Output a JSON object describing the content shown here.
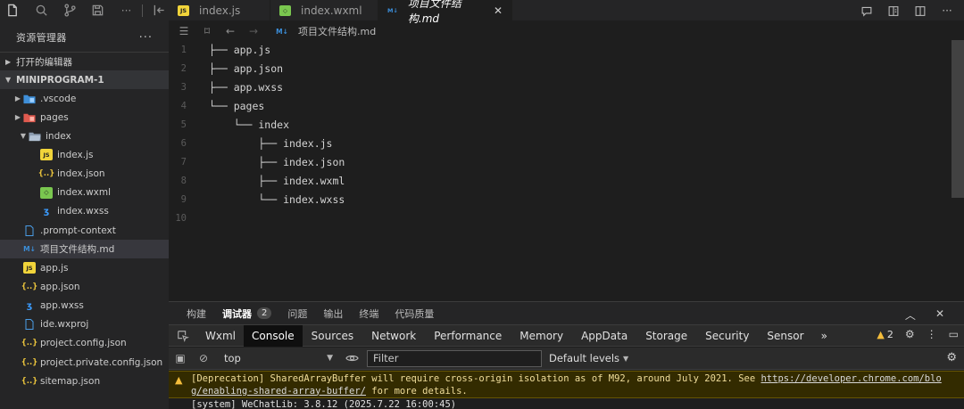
{
  "editor_tabs": [
    {
      "label": "index.js",
      "icon": "js"
    },
    {
      "label": "index.wxml",
      "icon": "wxml"
    },
    {
      "label": "项目文件结构.md",
      "icon": "md",
      "active": true
    }
  ],
  "sidebar": {
    "title": "资源管理器",
    "more": "···",
    "open_editors": "打开的编辑器",
    "project": "MINIPROGRAM-1",
    "tree": [
      {
        "label": ".vscode",
        "icon": "folder-blue",
        "indent": 1,
        "twisty": "▶"
      },
      {
        "label": "pages",
        "icon": "folder-red",
        "indent": 1,
        "twisty": "▶"
      },
      {
        "label": "index",
        "icon": "folder-grey",
        "indent": 2,
        "twisty": "▼"
      },
      {
        "label": "index.js",
        "icon": "js",
        "indent": 3
      },
      {
        "label": "index.json",
        "icon": "json",
        "indent": 3
      },
      {
        "label": "index.wxml",
        "icon": "wxml",
        "indent": 3
      },
      {
        "label": "index.wxss",
        "icon": "wxss",
        "indent": 3
      },
      {
        "label": ".prompt-context",
        "icon": "file",
        "indent": 1
      },
      {
        "label": "项目文件结构.md",
        "icon": "md",
        "indent": 1,
        "selected": true
      },
      {
        "label": "app.js",
        "icon": "js",
        "indent": 1
      },
      {
        "label": "app.json",
        "icon": "json",
        "indent": 1
      },
      {
        "label": "app.wxss",
        "icon": "wxss",
        "indent": 1
      },
      {
        "label": "ide.wxproj",
        "icon": "file",
        "indent": 1
      },
      {
        "label": "project.config.json",
        "icon": "json",
        "indent": 1
      },
      {
        "label": "project.private.config.json",
        "icon": "json",
        "indent": 1
      },
      {
        "label": "sitemap.json",
        "icon": "json",
        "indent": 1
      }
    ]
  },
  "breadcrumb": {
    "file": "项目文件结构.md"
  },
  "code_lines": [
    {
      "n": "1",
      "text": "├── app.js"
    },
    {
      "n": "2",
      "text": "├── app.json"
    },
    {
      "n": "3",
      "text": "├── app.wxss"
    },
    {
      "n": "4",
      "text": "└── pages"
    },
    {
      "n": "5",
      "text": "    └── index"
    },
    {
      "n": "6",
      "text": "        ├── index.js"
    },
    {
      "n": "7",
      "text": "        ├── index.json"
    },
    {
      "n": "8",
      "text": "        ├── index.wxml"
    },
    {
      "n": "9",
      "text": "        └── index.wxss"
    },
    {
      "n": "10",
      "text": ""
    }
  ],
  "panel": {
    "tabs": [
      {
        "label": "构建"
      },
      {
        "label": "调试器",
        "badge": "2",
        "active": true
      },
      {
        "label": "问题"
      },
      {
        "label": "输出"
      },
      {
        "label": "终端"
      },
      {
        "label": "代码质量"
      }
    ]
  },
  "devtools": {
    "tabs": [
      "Wxml",
      "Console",
      "Sources",
      "Network",
      "Performance",
      "Memory",
      "AppData",
      "Storage",
      "Security",
      "Sensor"
    ],
    "active_tab": "Console",
    "more": "»",
    "warning_count": "2",
    "context": "top",
    "filter_placeholder": "Filter",
    "levels": "Default levels"
  },
  "console": {
    "warning_text_1": "[Deprecation] SharedArrayBuffer will require cross-origin isolation as of M92, around July 2021. See ",
    "warning_link_1": "https://developer.chrome.com/blo",
    "warning_link_2": "g/enabling-shared-array-buffer/",
    "warning_text_2": " for more details.",
    "system_line": "[system] WeChatLib: 3.8.12 (2025.7.22 16:00:45)"
  },
  "colors": {
    "accent_warning": "#f4bd3b",
    "selection": "#37373d"
  }
}
